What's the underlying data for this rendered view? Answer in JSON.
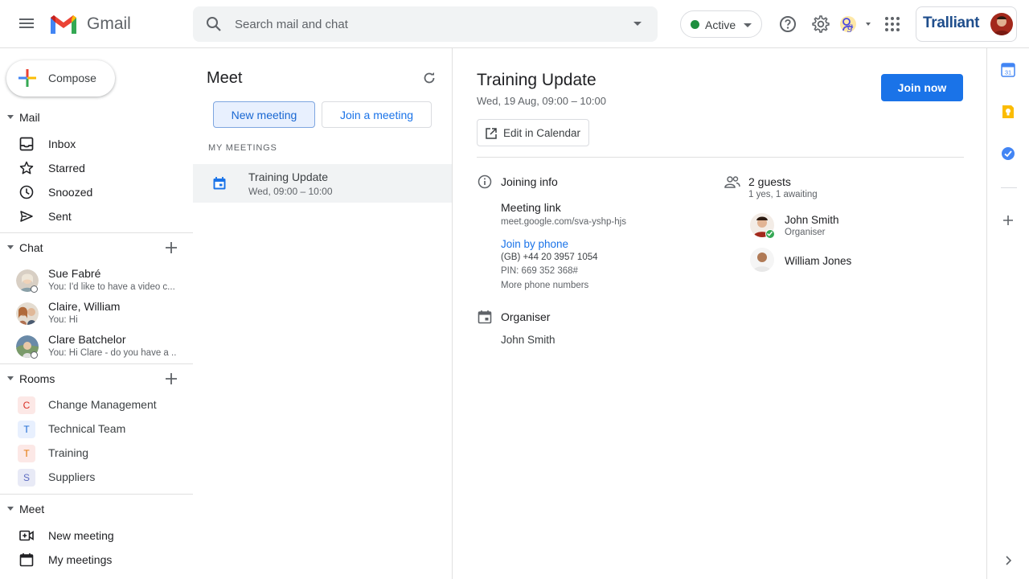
{
  "header": {
    "app_name": "Gmail",
    "search_placeholder": "Search mail and chat",
    "status_label": "Active",
    "account_brand": "Tralliant"
  },
  "leftnav": {
    "compose_label": "Compose",
    "mail_section": "Mail",
    "mail_items": [
      {
        "label": "Inbox",
        "icon": "inbox-icon"
      },
      {
        "label": "Starred",
        "icon": "star-icon"
      },
      {
        "label": "Snoozed",
        "icon": "clock-icon"
      },
      {
        "label": "Sent",
        "icon": "send-icon"
      }
    ],
    "chat_section": "Chat",
    "chats": [
      {
        "name": "Sue Fabré",
        "snippet": "You: I'd like to have a video c..."
      },
      {
        "name": "Claire, William",
        "snippet": "You: Hi"
      },
      {
        "name": "Clare Batchelor",
        "snippet": "You: Hi Clare - do you have a ..."
      }
    ],
    "rooms_section": "Rooms",
    "rooms": [
      {
        "letter": "C",
        "label": "Change Management",
        "bg": "#fce8e6",
        "fg": "#d93025"
      },
      {
        "letter": "T",
        "label": "Technical Team",
        "bg": "#e8f0fe",
        "fg": "#1967d2"
      },
      {
        "letter": "T",
        "label": "Training",
        "bg": "#fce8e6",
        "fg": "#e37400"
      },
      {
        "letter": "S",
        "label": "Suppliers",
        "bg": "#e8eaf6",
        "fg": "#5c6bc0"
      }
    ],
    "meet_section": "Meet",
    "meet_items": [
      {
        "label": "New meeting",
        "icon": "video-add-icon"
      },
      {
        "label": "My meetings",
        "icon": "calendar-icon"
      }
    ]
  },
  "meet": {
    "title": "Meet",
    "new_meeting_label": "New meeting",
    "join_meeting_label": "Join a meeting",
    "my_meetings_label": "MY MEETINGS",
    "meetings": [
      {
        "title": "Training Update",
        "time": "Wed, 09:00 – 10:00"
      }
    ]
  },
  "detail": {
    "title": "Training Update",
    "datetime": "Wed, 19 Aug, 09:00 – 10:00",
    "join_now_label": "Join now",
    "edit_calendar_label": "Edit in Calendar",
    "joining_info_label": "Joining info",
    "meeting_link_label": "Meeting link",
    "meeting_link": "meet.google.com/sva-yshp-hjs",
    "join_by_phone_label": "Join by phone",
    "phone": "(GB) +44 20 3957 1054",
    "pin": "PIN: 669 352 368#",
    "more_phone_label": "More phone numbers",
    "organiser_label": "Organiser",
    "organiser_name": "John Smith",
    "guests_count": "2 guests",
    "guests_status": "1 yes, 1 awaiting",
    "guests": [
      {
        "name": "John Smith",
        "role": "Organiser"
      },
      {
        "name": "William Jones",
        "role": ""
      }
    ]
  },
  "colors": {
    "accent": "#1a73e8",
    "active_green": "#1e8e3e"
  }
}
